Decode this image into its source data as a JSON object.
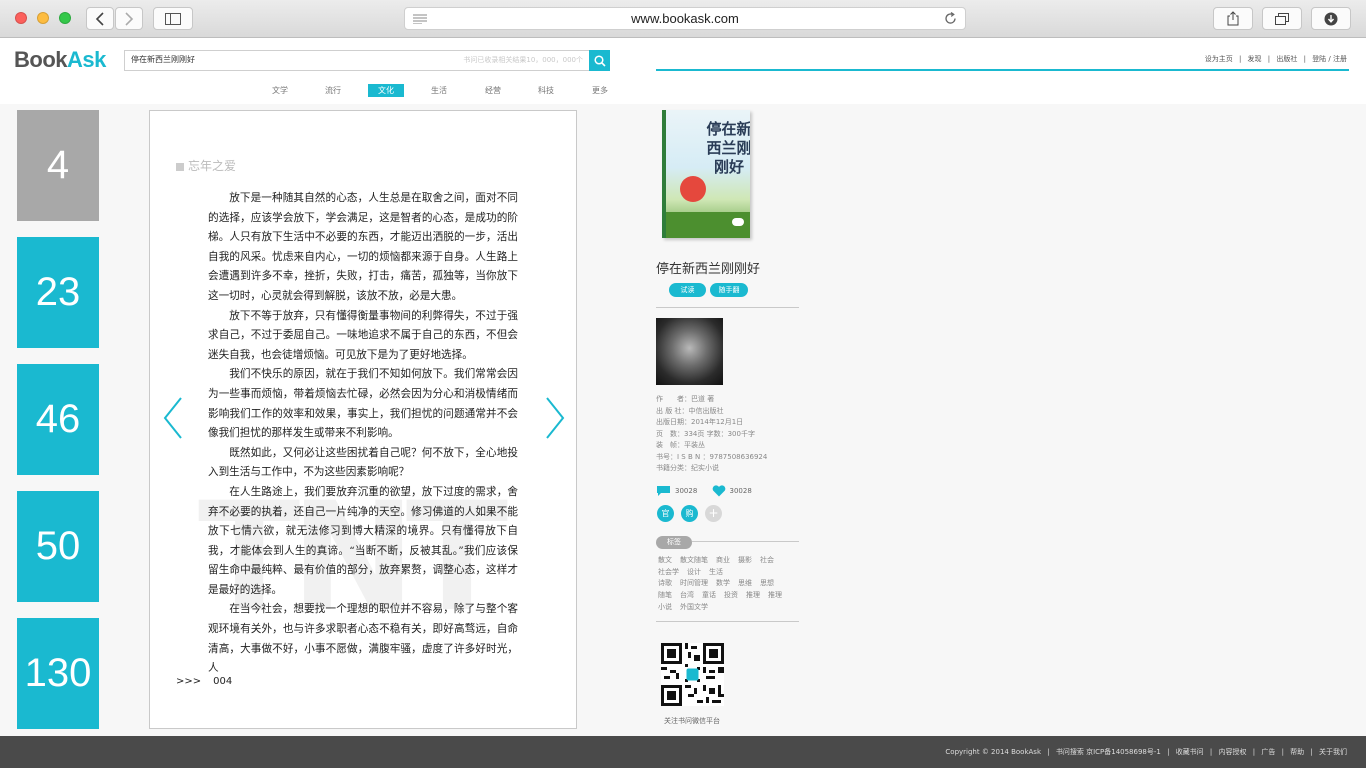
{
  "browser": {
    "url": "www.bookask.com"
  },
  "site": {
    "logo_part1": "Book",
    "logo_part2": "Ask",
    "search_value": "停在新西兰刚刚好",
    "search_placeholder": "书问已收录相关结果10，000，000个",
    "top_links": [
      "设为主页",
      "|",
      "发现",
      "|",
      "出版社",
      "|",
      "登陆 / 注册"
    ],
    "categories": [
      "文学",
      "流行",
      "文化",
      "生活",
      "经营",
      "科技",
      "更多"
    ],
    "active_category": "文化",
    "accent_color": "#1ab9d0"
  },
  "sidebar_tiles": [
    "4",
    "23",
    "46",
    "50",
    "130"
  ],
  "reader": {
    "chapter": "忘年之爱",
    "paragraphs": [
      "放下是一种随其自然的心态，人生总是在取舍之间，面对不同的选择，应该学会放下，学会满足，这是智者的心态，是成功的阶梯。人只有放下生活中不必要的东西，才能迈出洒脱的一步，活出自我的风采。忧虑来自内心，一切的烦恼都来源于自身。人生路上会遭遇到许多不幸，挫折，失败，打击，痛苦，孤独等，当你放下这一切时，心灵就会得到解脱，该放不放，必是大患。",
      "放下不等于放弃，只有懂得衡量事物间的利弊得失，不过于强求自己，不过于委屈自己。一味地追求不属于自己的东西，不但会迷失自我，也会徒增烦恼。可见放下是为了更好地选择。",
      "我们不快乐的原因，就在于我们不知如何放下。我们常常会因为一些事而烦恼，带着烦恼去忙碌，必然会因为分心和消极情绪而影响我们工作的效率和效果，事实上，我们担忧的问题通常并不会像我们担忧的那样发生或带来不利影响。",
      "既然如此，又何必让这些困扰着自己呢？何不放下，全心地投入到生活与工作中，不为这些因素影响呢？",
      "在人生路途上，我们要放弃沉重的欲望，放下过度的需求，舍弃不必要的执着，还自己一片纯净的天空。修习佛道的人如果不能放下七情六欲，就无法修习到博大精深的境界。只有懂得放下自我，才能体会到人生的真谛。“当断不断，反被其乱。”我们应该保留生命中最纯粹、最有价值的部分，放弃累赘，调整心态，这样才是最好的选择。",
      "在当今社会，想要找一个理想的职位并不容易，除了与整个客观环境有关外，也与许多求职者心态不稳有关，即好高骛远，自命清高，大事做不好，小事不愿做，满腹牢骚，虚度了许多好时光，人"
    ],
    "page_prefix": ">>>",
    "page_number": "004"
  },
  "book": {
    "cover_title": "停在新西兰刚刚好",
    "title": "停在新西兰刚刚好",
    "btn_trial": "试读",
    "btn_notes": "随手翻",
    "meta": [
      "作　　者：巴道 著",
      "出 版 社：中信出版社",
      "出版日期：2014年12月1日",
      "页　数：334页 字数：300千字",
      "装　帧：平装丛",
      "书号：I S B N ：9787508636924",
      "书籍分类：纪实小说"
    ],
    "comments_count": "30028",
    "likes_count": "30028",
    "btn_official": "官",
    "btn_buy": "购",
    "btn_more": "+",
    "tags_label": "标签",
    "tag_rows": [
      [
        "散文",
        "散文随笔",
        "商业",
        "摄影",
        "社会"
      ],
      [
        "社会学",
        "设计",
        "生活"
      ],
      [
        "诗歌",
        "时间管理",
        "数学",
        "思维",
        "思想"
      ],
      [
        "随笔",
        "台湾",
        "童话",
        "投资",
        "推理",
        "推理"
      ],
      [
        "小说",
        "外国文学"
      ]
    ],
    "qr_caption": "关注书问微信平台"
  },
  "footer": {
    "items": [
      "Copyright © 2014 BookAsk",
      "|",
      "书问搜索 京ICP备14058698号-1",
      "|",
      "收藏书问",
      "|",
      "内容授权",
      "|",
      "广告",
      "|",
      "帮助",
      "|",
      "关于我们"
    ]
  }
}
